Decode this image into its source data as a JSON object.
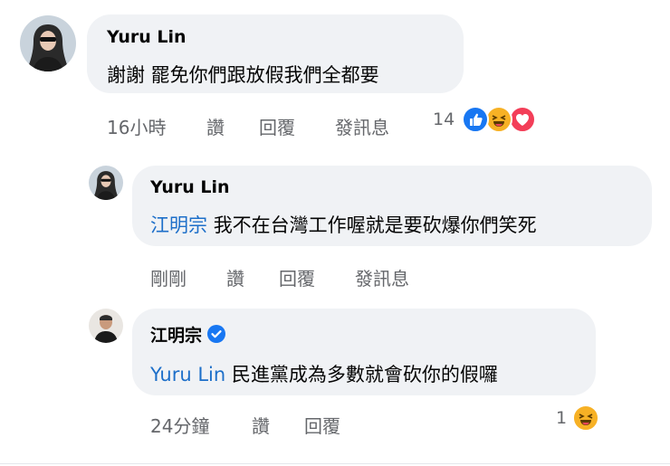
{
  "comments": [
    {
      "author": "Yuru Lin",
      "text": "謝謝 罷免你們跟放假我們全都要",
      "time": "16小時",
      "actions": {
        "like": "讚",
        "reply": "回覆",
        "message": "發訊息"
      },
      "reaction_count": "14",
      "reactions": [
        "like-icon",
        "haha-icon",
        "love-icon"
      ]
    },
    {
      "author": "Yuru Lin",
      "mention": "江明宗",
      "text": "我不在台灣工作喔就是要砍爆你們笑死",
      "time": "剛剛",
      "actions": {
        "like": "讚",
        "reply": "回覆",
        "message": "發訊息"
      }
    },
    {
      "author": "江明宗",
      "verified": true,
      "mention": "Yuru Lin",
      "text": "民進黨成為多數就會砍你的假囉",
      "time": "24分鐘",
      "actions": {
        "like": "讚",
        "reply": "回覆"
      },
      "reaction_count": "1",
      "reactions": [
        "haha-icon"
      ]
    }
  ],
  "colors": {
    "bubble": "#f0f2f5",
    "mention": "#1d6fc9",
    "meta": "#65676b",
    "like": "#1877f2",
    "love": "#f33e58",
    "haha": "#f7b125"
  }
}
